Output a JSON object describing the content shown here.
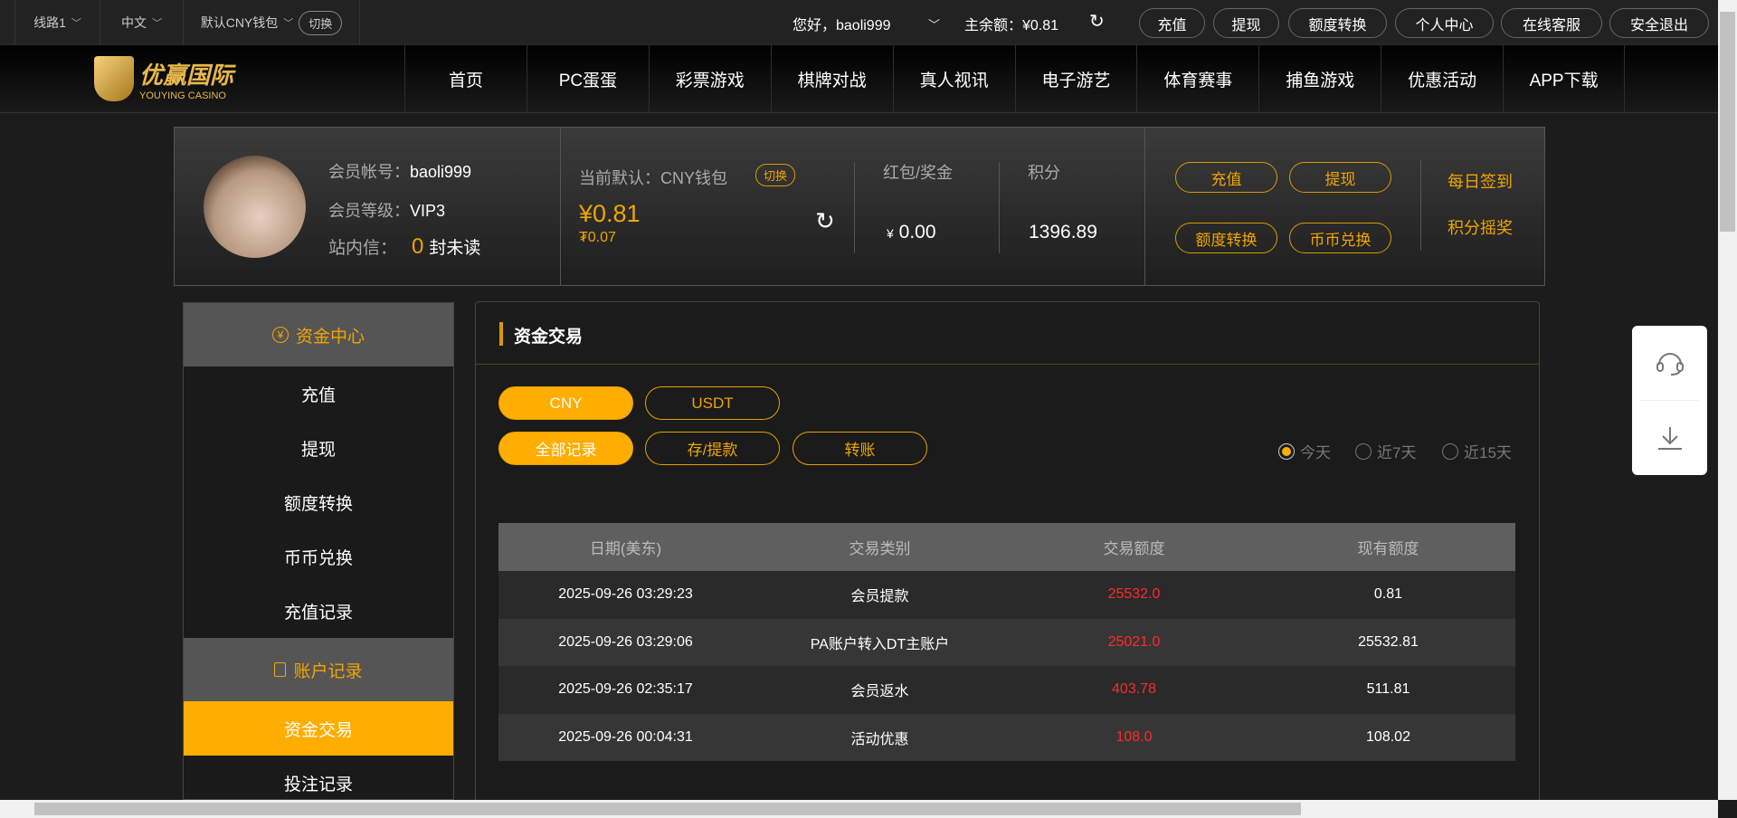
{
  "topbar": {
    "line": "线路1",
    "lang": "中文",
    "wallet": "默认CNY钱包",
    "switch": "切换",
    "greeting": "您好，baoli999",
    "balance": "主余额：¥0.81",
    "buttons": [
      "充值",
      "提现",
      "额度转换",
      "个人中心",
      "在线客服",
      "安全退出"
    ]
  },
  "logo": {
    "cn": "优赢国际",
    "en": "YOUYING CASINO"
  },
  "nav": [
    "首页",
    "PC蛋蛋",
    "彩票游戏",
    "棋牌对战",
    "真人视讯",
    "电子游艺",
    "体育赛事",
    "捕鱼游戏",
    "优惠活动",
    "APP下载"
  ],
  "profile": {
    "account_label": "会员帐号：",
    "account": "baoli999",
    "level_label": "会员等级：",
    "level": "VIP3",
    "msg_label": "站内信：",
    "msg_count": "0",
    "msg_suffix": "封未读",
    "wallet_label": "当前默认：CNY钱包",
    "wallet_switch": "切换",
    "cny": "¥0.81",
    "usdt": "₮0.07",
    "bonus_label": "红包/奖金",
    "bonus_currency": "¥",
    "bonus": "0.00",
    "points_label": "积分",
    "points": "1396.89",
    "actions": [
      "充值",
      "提现",
      "额度转换",
      "币币兑换"
    ],
    "links": [
      "每日签到",
      "积分摇奖"
    ]
  },
  "sidebar": {
    "fund_center": "资金中心",
    "fund_items": [
      "充值",
      "提现",
      "额度转换",
      "币币兑换",
      "充值记录"
    ],
    "account_records": "账户记录",
    "record_items": [
      "资金交易",
      "投注记录"
    ]
  },
  "main": {
    "title": "资金交易",
    "currencies": [
      "CNY",
      "USDT"
    ],
    "types": [
      "全部记录",
      "存/提款",
      "转账"
    ],
    "ranges": [
      "今天",
      "近7天",
      "近15天"
    ],
    "columns": [
      "日期(美东)",
      "交易类别",
      "交易额度",
      "现有额度"
    ],
    "rows": [
      [
        "2025-09-26 03:29:23",
        "会员提款",
        "25532.0",
        "0.81"
      ],
      [
        "2025-09-26 03:29:06",
        "PA账户转入DT主账户",
        "25021.0",
        "25532.81"
      ],
      [
        "2025-09-26 02:35:17",
        "会员返水",
        "403.78",
        "511.81"
      ],
      [
        "2025-09-26 00:04:31",
        "活动优惠",
        "108.0",
        "108.02"
      ]
    ]
  },
  "colors": {
    "accent": "#ffad00",
    "negative": "#ff2a2a"
  }
}
